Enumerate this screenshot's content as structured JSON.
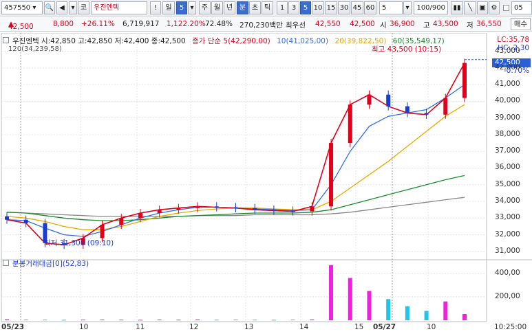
{
  "toolbar": {
    "code": "457550",
    "market": "코",
    "name": "우진엔텍",
    "alert": "!",
    "period_day": "일",
    "interval": "5",
    "week": "주",
    "month": "월",
    "year": "년",
    "minute": "분",
    "second": "초",
    "tick": "틱",
    "n1": "1",
    "n3": "3",
    "n5": "5",
    "n10": "10",
    "n15": "15",
    "n30": "30",
    "n45": "45",
    "n60": "60",
    "count": "5",
    "range": "100/900",
    "right_input": "05"
  },
  "pricebar": {
    "price": "42,500",
    "change": "8,800",
    "pct": "+26.11%",
    "volume": "6,719,917",
    "vol_ratio": "1,122.20%",
    "turnover": "72.48%",
    "amount": "270,230백만",
    "best_ask_label": "최우선",
    "best_ask": "42,550",
    "best_bid": "42,500",
    "open_label": "시",
    "open": "36,900",
    "high_label": "고",
    "high": "43,500",
    "low_label": "저",
    "low": "36,550",
    "buy_label": "매수"
  },
  "legend": {
    "ohlc": "우진엔텍 시:42,850 고:42,850 저:42,400 종:42,500",
    "ma5": "종가 단순 5(42,290,00)",
    "ma10": "10(41,025,00)",
    "ma20": "20(39,822,50)",
    "ma60": "60(35,549,17)",
    "ma120": "120(34,239,58)",
    "volume": "분봉거래대금[0](52,83)"
  },
  "annotations": {
    "high": "최고 43,500 (10:15)",
    "low": "최저 31,300 (09:10)",
    "lc": "LC:35,78",
    "hc": "HC:-2,30",
    "current": "42,500",
    "current_pct": "-0.70%"
  },
  "axis": {
    "price_ticks": [
      "43,000",
      "42,000",
      "41,000",
      "40,000",
      "39,000",
      "38,000",
      "37,000",
      "36,000",
      "35,000",
      "34,000",
      "33,000",
      "32,000",
      "31,000"
    ],
    "volume_ticks": [
      "400,00",
      "200,00"
    ],
    "dates": [
      "05/23",
      "10",
      "11",
      "12",
      "13",
      "14",
      "15",
      "05/27",
      "10"
    ],
    "time": "10:25:00"
  },
  "colors": {
    "up": "#e0001b",
    "down": "#1a3bd6",
    "ma5": "#e0001b",
    "ma10": "#2d6fe8",
    "ma20": "#e8a800",
    "ma60": "#1a8a2a",
    "ma120": "#888888",
    "vol_up": "#ee22dd",
    "vol_down": "#22c4ee"
  },
  "chart_data": [
    {
      "type": "line",
      "title": "",
      "xlabel": "",
      "ylabel": "",
      "ylim": [
        30500,
        43600
      ],
      "series": [
        {
          "name": "종가 단순 5",
          "values": [
            32900,
            32700,
            31500,
            31400,
            31800,
            32600,
            33000,
            33300,
            33500,
            33600,
            33700,
            33650,
            33600,
            33500,
            33450,
            33400,
            33700,
            37500,
            39800,
            40400,
            39700,
            39300,
            39200,
            40200,
            42300
          ]
        },
        {
          "name": "10",
          "values": [
            32900,
            32850,
            32400,
            32000,
            31900,
            32200,
            32600,
            33000,
            33300,
            33500,
            33650,
            33650,
            33600,
            33550,
            33500,
            33450,
            33500,
            35000,
            37000,
            38500,
            39100,
            39300,
            39500,
            40200,
            41000
          ]
        },
        {
          "name": "20",
          "values": [
            33100,
            33000,
            32800,
            32500,
            32300,
            32300,
            32500,
            32800,
            33100,
            33300,
            33450,
            33550,
            33600,
            33600,
            33550,
            33500,
            33500,
            34000,
            34800,
            35600,
            36400,
            37300,
            38200,
            39100,
            39800
          ]
        },
        {
          "name": "60",
          "values": [
            33350,
            33300,
            33150,
            33000,
            32900,
            32850,
            32850,
            32900,
            33000,
            33100,
            33150,
            33200,
            33250,
            33300,
            33300,
            33300,
            33350,
            33500,
            33800,
            34100,
            34400,
            34700,
            35000,
            35300,
            35550
          ]
        },
        {
          "name": "120",
          "values": [
            33350,
            33300,
            33250,
            33200,
            33150,
            33100,
            33100,
            33100,
            33100,
            33100,
            33150,
            33150,
            33150,
            33200,
            33200,
            33200,
            33200,
            33250,
            33350,
            33500,
            33650,
            33800,
            33950,
            34100,
            34240
          ]
        }
      ]
    },
    {
      "type": "bar",
      "title": "",
      "ylim": [
        0,
        480
      ],
      "series": [
        {
          "name": "분봉거래대금",
          "values": [
            8,
            6,
            5,
            4,
            5,
            6,
            5,
            4,
            6,
            5,
            7,
            5,
            6,
            5,
            4,
            6,
            7,
            470,
            360,
            250,
            180,
            120,
            80,
            160,
            52.83
          ]
        }
      ]
    }
  ]
}
